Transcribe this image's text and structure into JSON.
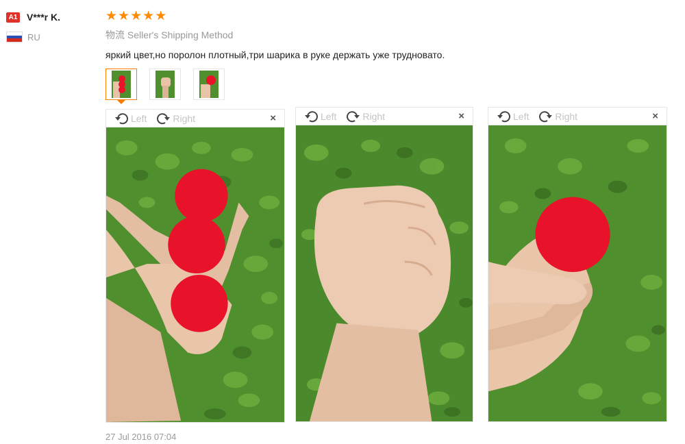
{
  "user": {
    "level_badge": "A1",
    "name": "V***r K.",
    "country": "RU"
  },
  "review": {
    "rating": 5,
    "shipping_prefix": "物流",
    "shipping_method": "Seller's Shipping Method",
    "text": "яркий цвет,но поролон плотный,три шарика в руке держать уже трудновато.",
    "date": "27 Jul 2016 07:04"
  },
  "viewer": {
    "rotate_left_label": "Left",
    "rotate_right_label": "Right",
    "close_label": "×"
  },
  "colors": {
    "star": "#ff8a00",
    "accent": "#ff7a00",
    "ball": "#e8122a",
    "grass": "#4f8f2e"
  },
  "photos": [
    {
      "description_icon": "photo-three-balls"
    },
    {
      "description_icon": "photo-fist"
    },
    {
      "description_icon": "photo-one-ball"
    }
  ]
}
